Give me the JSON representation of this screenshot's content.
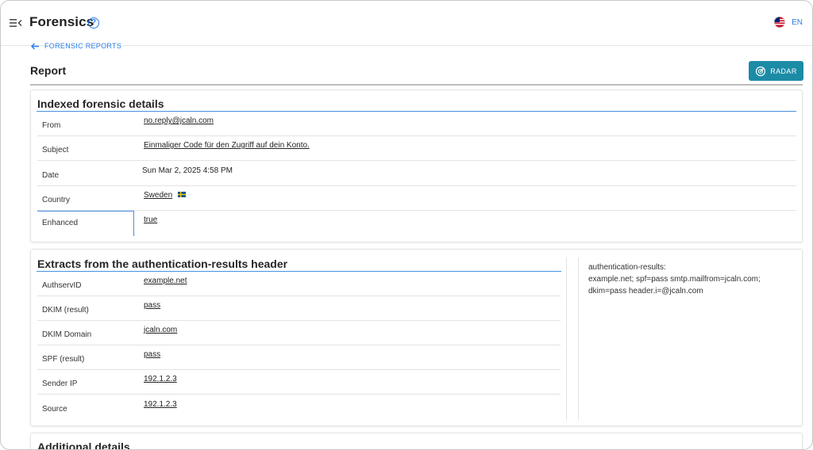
{
  "app": {
    "title": "Forensics",
    "help_icon": "?",
    "language": "EN"
  },
  "breadcrumb": {
    "back_label": "FORENSIC REPORTS"
  },
  "page": {
    "title": "Report",
    "radar_label": "RADAR"
  },
  "indexed": {
    "heading": "Indexed forensic details",
    "rows": [
      {
        "label": "From",
        "value": "no.reply@jcaln.com"
      },
      {
        "label": "Subject",
        "value": "Einmaliger Code für den Zugriff auf dein Konto."
      },
      {
        "label": "Date",
        "value": "Sun Mar 2, 2025 4:58 PM"
      },
      {
        "label": "Country",
        "value": "Sweden"
      },
      {
        "label": "Enhanced",
        "value": "true"
      }
    ]
  },
  "auth": {
    "heading": "Extracts from the authentication-results header",
    "rows": [
      {
        "label": "AuthservID",
        "value": "example.net"
      },
      {
        "label": "DKIM (result)",
        "value": "pass"
      },
      {
        "label": "DKIM Domain",
        "value": "jcaln.com"
      },
      {
        "label": "SPF (result)",
        "value": "pass"
      },
      {
        "label": "Sender IP",
        "value": "192.1.2.3"
      },
      {
        "label": "Source",
        "value": "192.1.2.3"
      }
    ],
    "raw": {
      "line1": "authentication-results:",
      "line2": "example.net; spf=pass smtp.mailfrom=jcaln.com;",
      "line3": "dkim=pass header.i=@jcaln.com"
    }
  },
  "additional": {
    "heading": "Additional details"
  },
  "colors": {
    "accent": "#2b7de9",
    "radar_button": "#1c8ba6",
    "heading_rule": "#4a90e2"
  },
  "icons": {
    "menu": "menu-collapse-icon",
    "help": "help-circle-icon",
    "flag": "us-uk-flag-icon",
    "back": "arrow-left-icon",
    "radar": "radar-icon",
    "country_flag": "sweden-flag-icon"
  }
}
